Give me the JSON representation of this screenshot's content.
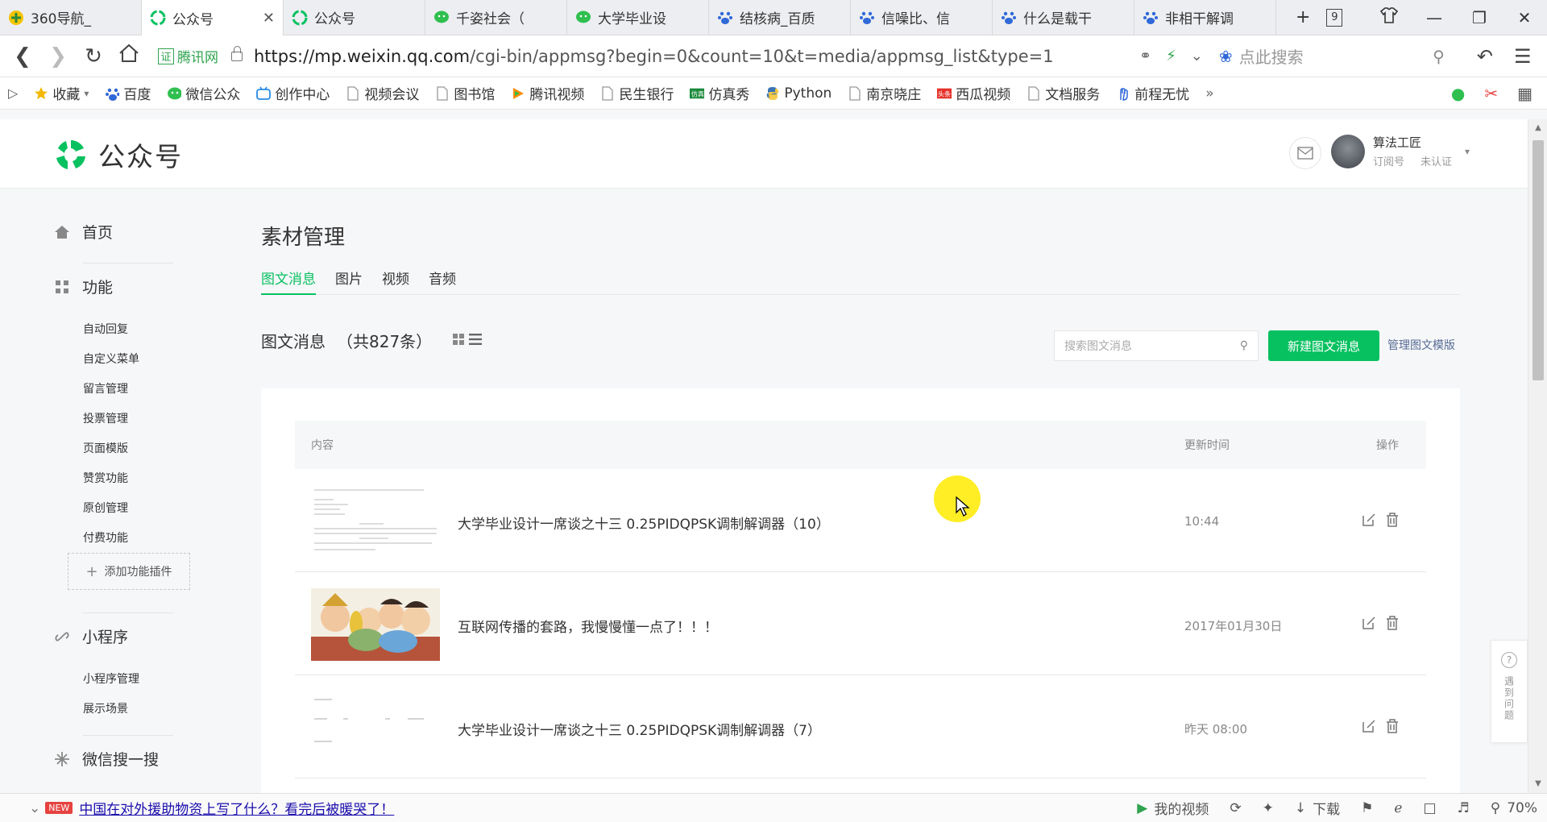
{
  "browser": {
    "tabs": [
      {
        "label": "360导航_",
        "icon": "360-icon",
        "active": false
      },
      {
        "label": "公众号",
        "icon": "wechat-mp-icon",
        "active": true
      },
      {
        "label": "公众号",
        "icon": "wechat-mp-icon",
        "active": false
      },
      {
        "label": "千姿社会（",
        "icon": "wechat-icon",
        "active": false
      },
      {
        "label": "大学毕业设",
        "icon": "wechat-icon",
        "active": false
      },
      {
        "label": "结核病_百质",
        "icon": "baidu-paw-icon",
        "active": false
      },
      {
        "label": "信噪比、信",
        "icon": "baidu-paw-icon",
        "active": false
      },
      {
        "label": "什么是载干",
        "icon": "baidu-paw-icon",
        "active": false
      },
      {
        "label": "非相干解调",
        "icon": "baidu-paw-icon",
        "active": false
      }
    ],
    "tab_count": "9",
    "cert_label": "腾讯网",
    "url_host": "https://mp.weixin.qq.com",
    "url_path": "/cgi-bin/appmsg?begin=0&count=10&t=media/appmsg_list&type=1",
    "search_placeholder": "点此搜索",
    "bookmarks": [
      {
        "label": "收藏",
        "icon": "star-icon"
      },
      {
        "label": "百度",
        "icon": "baidu-paw-icon"
      },
      {
        "label": "微信公众",
        "icon": "wechat-icon"
      },
      {
        "label": "创作中心",
        "icon": "bilibili-icon"
      },
      {
        "label": "视频会议",
        "icon": "page-icon"
      },
      {
        "label": "图书馆",
        "icon": "page-icon"
      },
      {
        "label": "腾讯视频",
        "icon": "tencent-video-icon"
      },
      {
        "label": "民生银行",
        "icon": "page-icon"
      },
      {
        "label": "仿真秀",
        "icon": "fangzhenxiu-icon"
      },
      {
        "label": "Python",
        "icon": "python-icon"
      },
      {
        "label": "南京晓庄",
        "icon": "page-icon"
      },
      {
        "label": "西瓜视频",
        "icon": "xigua-icon"
      },
      {
        "label": "文档服务",
        "icon": "page-icon"
      },
      {
        "label": "前程无忧",
        "icon": "hand-icon"
      }
    ]
  },
  "site": {
    "logo_text": "公众号",
    "account_name": "算法工匠",
    "account_type": "订阅号",
    "account_status": "未认证"
  },
  "sidebar": {
    "home": "首页",
    "features": "功能",
    "feature_items": [
      "自动回复",
      "自定义菜单",
      "留言管理",
      "投票管理",
      "页面模版",
      "赞赏功能",
      "原创管理",
      "付费功能"
    ],
    "add_plugin": "添加功能插件",
    "miniprogram": "小程序",
    "miniprogram_items": [
      "小程序管理",
      "展示场景"
    ],
    "wechat_search": "微信搜一搜"
  },
  "main": {
    "title": "素材管理",
    "tabs": [
      "图文消息",
      "图片",
      "视频",
      "音频"
    ],
    "active_tab": "图文消息",
    "list_title": "图文消息",
    "list_count": "（共827条）",
    "search_placeholder": "搜索图文消息",
    "new_button": "新建图文消息",
    "template_link": "管理图文模版",
    "columns": {
      "content": "内容",
      "updated": "更新时间",
      "actions": "操作"
    },
    "rows": [
      {
        "title": "大学毕业设计一席谈之十三  0.25PIDQPSK调制解调器（10）",
        "time": "10:44",
        "thumb": "code"
      },
      {
        "title": "互联网传播的套路，我慢慢懂一点了！！！",
        "time": "2017年01月30日",
        "thumb": "cartoon"
      },
      {
        "title": "大学毕业设计一席谈之十三  0.25PIDQPSK调制解调器（7）",
        "time": "昨天 08:00",
        "thumb": "code2"
      }
    ]
  },
  "help": {
    "label": "遇到问题"
  },
  "statusbar": {
    "news_badge": "NEW",
    "news_text": "中国在对外援助物资上写了什么？看完后被暖哭了！",
    "my_video": "我的视频",
    "download": "下载",
    "zoom": "70%"
  },
  "colors": {
    "accent_green": "#07c160",
    "link_blue": "#576b95"
  }
}
